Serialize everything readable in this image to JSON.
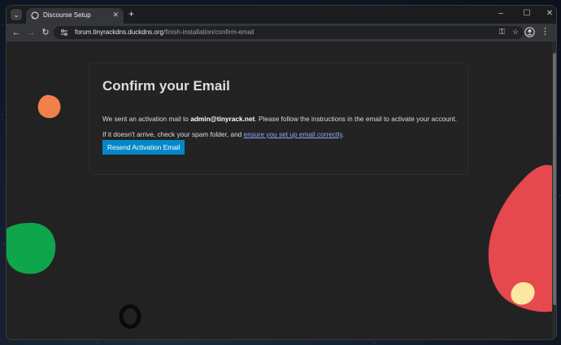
{
  "browser": {
    "tab": {
      "title": "Discourse Setup"
    },
    "url": {
      "domain": "forum.tinyrackdns.duckdns.org",
      "path": "/finish-installation/confirm-email"
    }
  },
  "page": {
    "title": "Confirm your Email",
    "line1_prefix": "We sent an activation mail to ",
    "line1_email": "admin@tinyrack.net",
    "line1_suffix": ". Please follow the instructions in the email to activate your account.",
    "line2_prefix": "If it doesn't arrive, check your spam folder, and ",
    "line2_link": "ensure you set up email correctly",
    "line2_suffix": ".",
    "button_label": "Resend Activation Email"
  },
  "colors": {
    "accent_button": "#0588c8",
    "link": "#8fa7ff",
    "decor_orange": "#f2804a",
    "decor_green": "#0fa54a",
    "decor_red": "#e5484d",
    "decor_yellow": "#fbe8a0"
  }
}
